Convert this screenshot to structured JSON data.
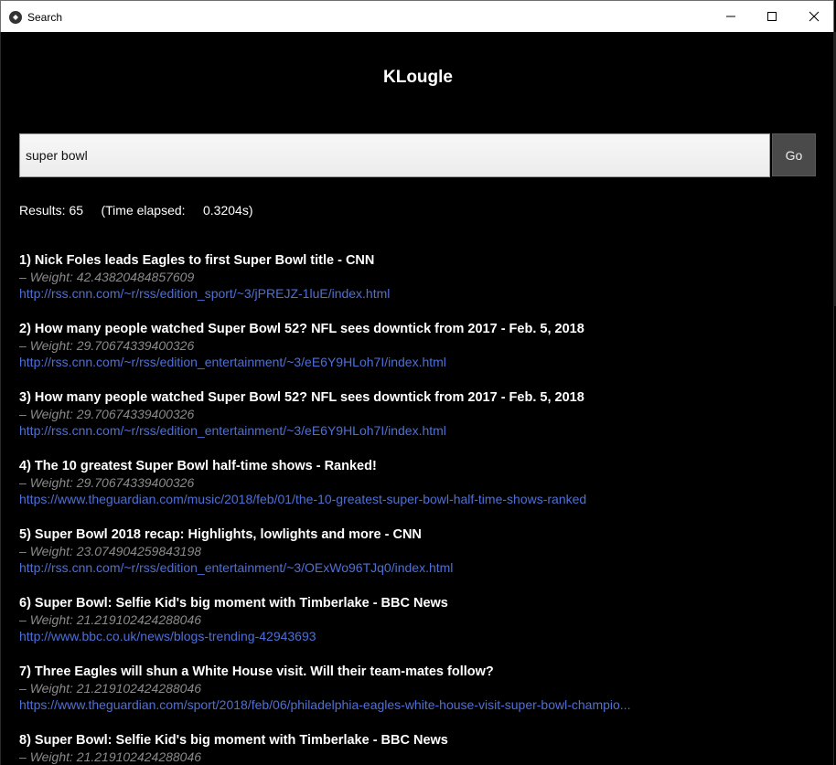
{
  "window": {
    "title": "Search"
  },
  "app": {
    "title": "KLougle"
  },
  "search": {
    "value": "super bowl",
    "placeholder": "",
    "go_label": "Go"
  },
  "stats": {
    "text": "Results: 65     (Time elapsed:     0.3204s)"
  },
  "results": [
    {
      "title": "1) Nick Foles leads Eagles to first Super Bowl title - CNN",
      "dash": "–",
      "weight": "Weight: 42.43820484857609",
      "url": "http://rss.cnn.com/~r/rss/edition_sport/~3/jPREJZ-1luE/index.html"
    },
    {
      "title": "2) How many people watched Super Bowl 52? NFL sees downtick from 2017 - Feb. 5, 2018",
      "dash": "–",
      "weight": "Weight: 29.70674339400326",
      "url": "http://rss.cnn.com/~r/rss/edition_entertainment/~3/eE6Y9HLoh7I/index.html"
    },
    {
      "title": "3) How many people watched Super Bowl 52? NFL sees downtick from 2017 - Feb. 5, 2018",
      "dash": "–",
      "weight": "Weight: 29.70674339400326",
      "url": "http://rss.cnn.com/~r/rss/edition_entertainment/~3/eE6Y9HLoh7I/index.html"
    },
    {
      "title": "4) The 10 greatest Super Bowl half-time shows - Ranked!",
      "dash": "–",
      "weight": "Weight: 29.70674339400326",
      "url": "https://www.theguardian.com/music/2018/feb/01/the-10-greatest-super-bowl-half-time-shows-ranked"
    },
    {
      "title": "5) Super Bowl 2018 recap: Highlights, lowlights and more  - CNN",
      "dash": "–",
      "weight": "Weight: 23.074904259843198",
      "url": "http://rss.cnn.com/~r/rss/edition_entertainment/~3/OExWo96TJq0/index.html"
    },
    {
      "title": "6) Super Bowl: Selfie Kid's big moment with Timberlake - BBC News",
      "dash": "–",
      "weight": "Weight: 21.219102424288046",
      "url": "http://www.bbc.co.uk/news/blogs-trending-42943693"
    },
    {
      "title": "7) Three Eagles will shun a White House visit. Will their team-mates follow?",
      "dash": "–",
      "weight": "Weight: 21.219102424288046",
      "url": "https://www.theguardian.com/sport/2018/feb/06/philadelphia-eagles-white-house-visit-super-bowl-champio..."
    },
    {
      "title": "8) Super Bowl: Selfie Kid's big moment with Timberlake - BBC News",
      "dash": "–",
      "weight": "Weight: 21.219102424288046",
      "url": ""
    }
  ],
  "colors": {
    "background": "#000000",
    "title_text": "#ffffff",
    "weight_text": "#8a8a8a",
    "link": "#4f6fd6",
    "go_button": "#4a4a4a"
  },
  "icons": {
    "app": "kivy-app-icon",
    "minimize": "minimize-icon",
    "maximize": "maximize-icon",
    "close": "close-icon"
  }
}
